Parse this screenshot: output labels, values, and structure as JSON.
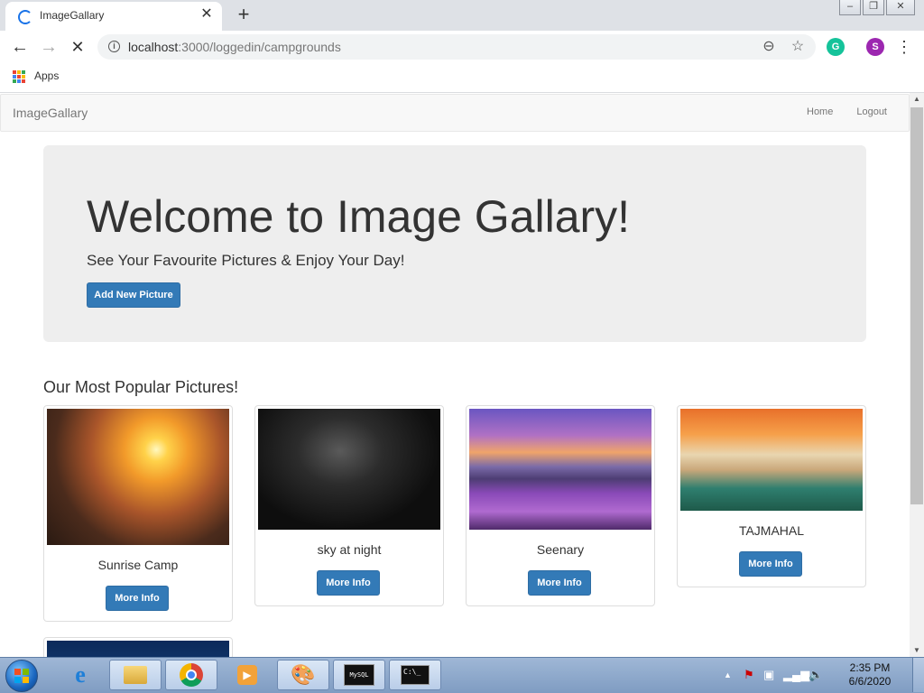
{
  "browser": {
    "tab_title": "ImageGallary",
    "new_tab_glyph": "+",
    "url_host": "localhost",
    "url_rest": ":3000/loggedin/campgrounds",
    "bookmarks": {
      "apps_label": "Apps"
    },
    "profile_initial": "S",
    "extension_initial": "G",
    "icons": [
      "back-arrow-icon",
      "forward-arrow-icon",
      "stop-loading-icon",
      "info-icon",
      "zoom-icon",
      "star-icon",
      "menu-dots-icon"
    ]
  },
  "navbar": {
    "brand": "ImageGallary",
    "links": {
      "home": "Home",
      "logout": "Logout"
    }
  },
  "jumbotron": {
    "title": "Welcome to Image Gallary!",
    "subtitle": "See Your Favourite Pictures & Enjoy Your Day!",
    "add_button": "Add New Picture"
  },
  "gallery": {
    "heading": "Our Most Popular Pictures!",
    "cards": [
      {
        "caption": "Sunrise Camp",
        "button": "More Info",
        "image": "sunrise-camp-photo"
      },
      {
        "caption": "sky at night",
        "button": "More Info",
        "image": "night-sky-photo"
      },
      {
        "caption": "Seenary",
        "button": "More Info",
        "image": "scenery-photo"
      },
      {
        "caption": "TAJMAHAL",
        "button": "More Info",
        "image": "tajmahal-photo"
      }
    ]
  },
  "taskbar": {
    "apps": [
      "internet-explorer-icon",
      "file-explorer-icon",
      "chrome-icon",
      "media-player-icon",
      "paint-icon",
      "mysql-icon",
      "cmd-icon"
    ],
    "mysql_label": "MySQL",
    "cmd_label": "C:\\_",
    "time": "2:35 PM",
    "date": "6/6/2020"
  },
  "colors": {
    "primary_button": "#337ab7",
    "navbar_bg": "#f8f8f8",
    "jumbotron_bg": "#eeeeee",
    "chrome_tab_strip": "#dee1e6",
    "taskbar": "#8fa9cc"
  }
}
